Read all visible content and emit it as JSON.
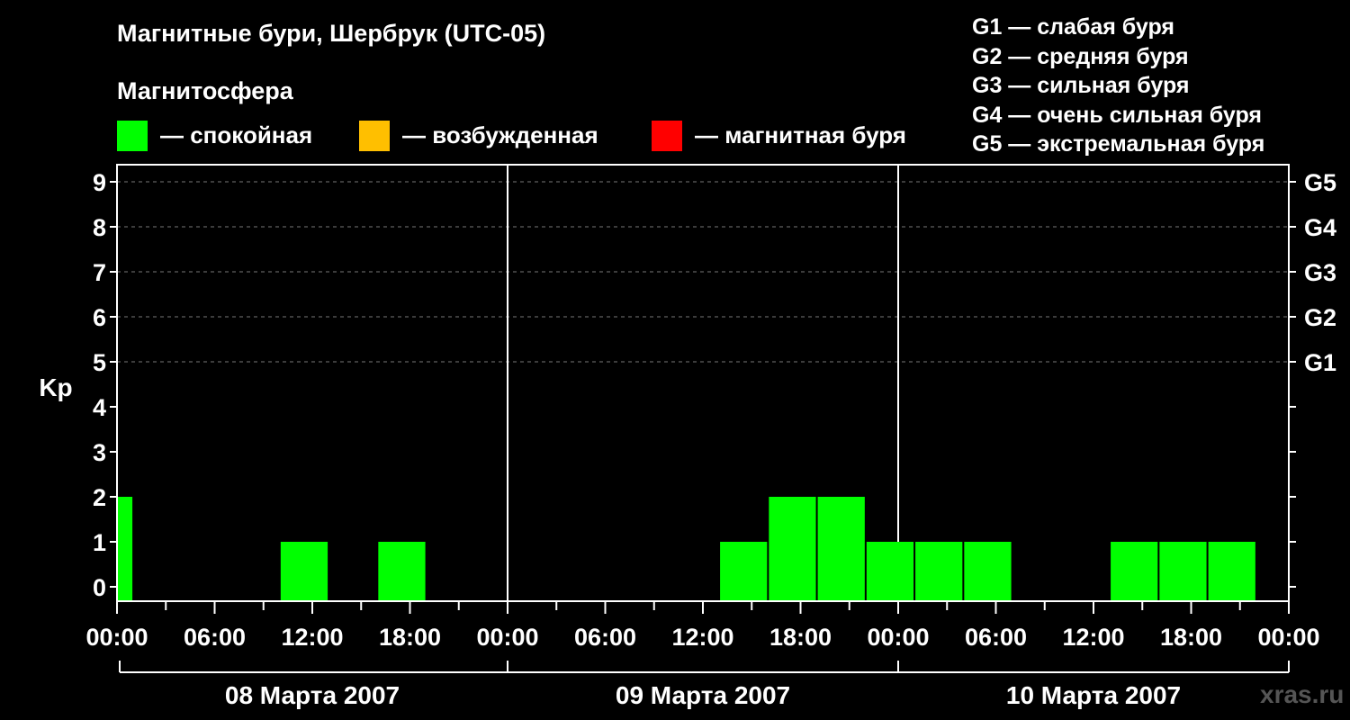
{
  "header": {
    "title": "Магнитные бури, Шербрук (UTC-05)",
    "magnetosphere_label": "Магнитосфера"
  },
  "legend": [
    {
      "color": "#00ff00",
      "label": "— спокойная"
    },
    {
      "color": "#ffbf00",
      "label": "— возбужденная"
    },
    {
      "color": "#ff0000",
      "label": "— магнитная буря"
    }
  ],
  "g_scale_legend": [
    "G1 — слабая буря",
    "G2 — средняя буря",
    "G3 — сильная буря",
    "G4 — очень сильная буря",
    "G5 — экстремальная буря"
  ],
  "watermark": "xras.ru",
  "chart_data": {
    "type": "bar",
    "ylabel": "Kp",
    "ylim": [
      0,
      9
    ],
    "yticks": [
      "0",
      "1",
      "2",
      "3",
      "4",
      "5",
      "6",
      "7",
      "8",
      "9"
    ],
    "right_ticks": [
      {
        "kp": 5,
        "label": "G1"
      },
      {
        "kp": 6,
        "label": "G2"
      },
      {
        "kp": 7,
        "label": "G3"
      },
      {
        "kp": 8,
        "label": "G4"
      },
      {
        "kp": 9,
        "label": "G5"
      }
    ],
    "xlim_hours": [
      0,
      72
    ],
    "xtick_labels": [
      "00:00",
      "06:00",
      "12:00",
      "18:00",
      "00:00",
      "06:00",
      "12:00",
      "18:00",
      "00:00",
      "06:00",
      "12:00",
      "18:00",
      "00:00"
    ],
    "days": [
      "08 Марта 2007",
      "09 Марта 2007",
      "10 Марта 2007"
    ],
    "grid": "dashed horizontal",
    "bars": [
      {
        "start_hour": 0,
        "end_hour": 1,
        "kp": 2,
        "color": "#00ff00"
      },
      {
        "start_hour": 10,
        "end_hour": 13,
        "kp": 1,
        "color": "#00ff00"
      },
      {
        "start_hour": 16,
        "end_hour": 19,
        "kp": 1,
        "color": "#00ff00"
      },
      {
        "start_hour": 37,
        "end_hour": 40,
        "kp": 1,
        "color": "#00ff00"
      },
      {
        "start_hour": 40,
        "end_hour": 43,
        "kp": 2,
        "color": "#00ff00"
      },
      {
        "start_hour": 43,
        "end_hour": 46,
        "kp": 2,
        "color": "#00ff00"
      },
      {
        "start_hour": 46,
        "end_hour": 49,
        "kp": 1,
        "color": "#00ff00"
      },
      {
        "start_hour": 49,
        "end_hour": 52,
        "kp": 1,
        "color": "#00ff00"
      },
      {
        "start_hour": 52,
        "end_hour": 55,
        "kp": 1,
        "color": "#00ff00"
      },
      {
        "start_hour": 61,
        "end_hour": 64,
        "kp": 1,
        "color": "#00ff00"
      },
      {
        "start_hour": 64,
        "end_hour": 67,
        "kp": 1,
        "color": "#00ff00"
      },
      {
        "start_hour": 67,
        "end_hour": 70,
        "kp": 1,
        "color": "#00ff00"
      }
    ]
  }
}
